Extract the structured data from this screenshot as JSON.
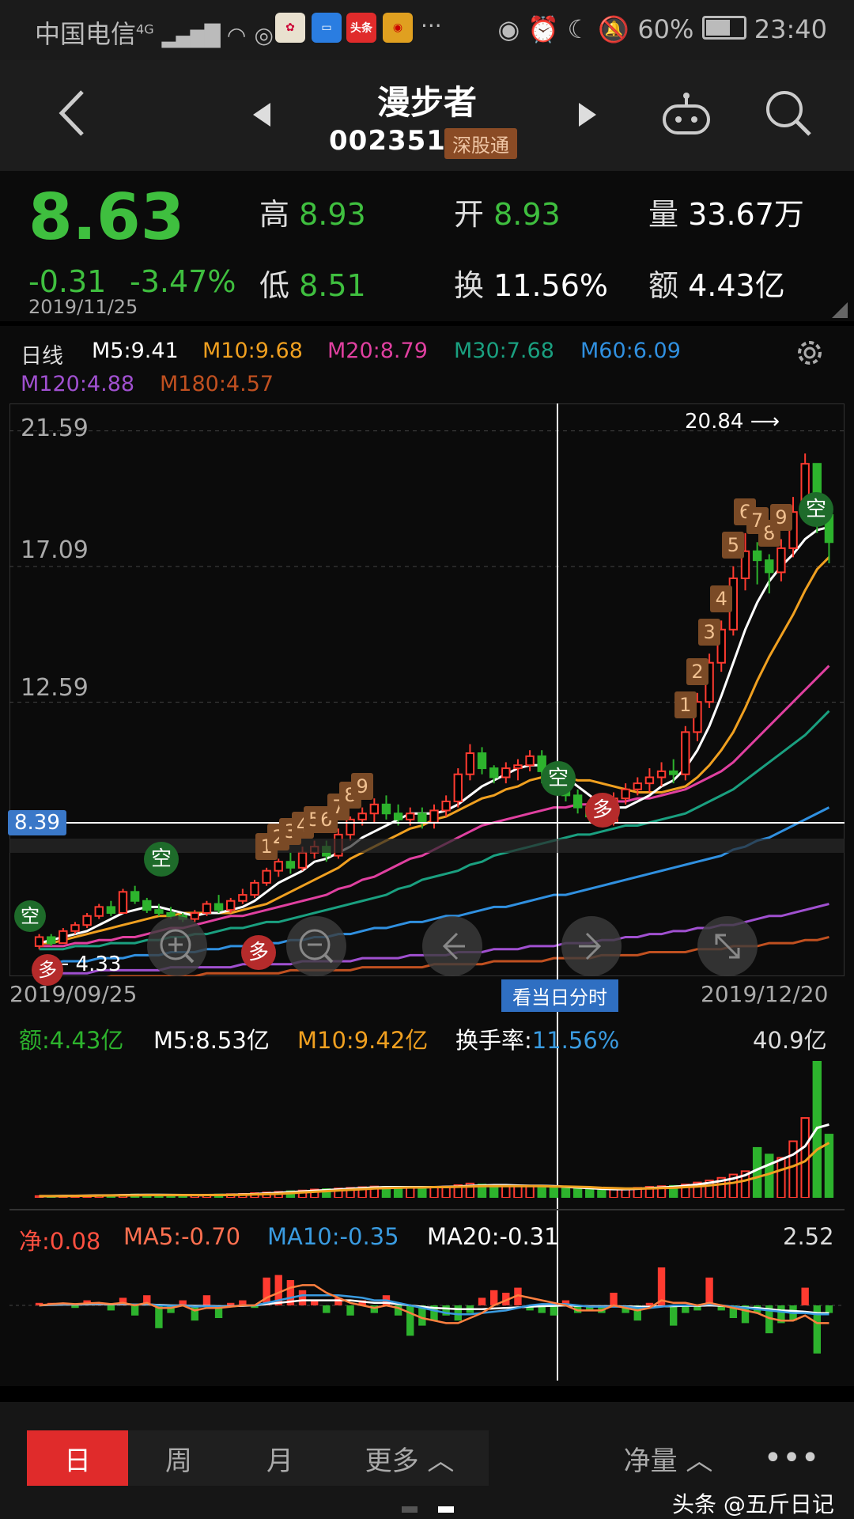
{
  "status_bar": {
    "carrier": "中国电信",
    "network": "4G",
    "apps": [
      {
        "name": "app1",
        "label": "",
        "color": "#e0e0e0"
      },
      {
        "name": "app2",
        "label": "",
        "color": "#2a7de1"
      },
      {
        "name": "toutiao",
        "label": "头条",
        "color": "#e02b2b"
      },
      {
        "name": "weibo",
        "label": "",
        "color": "#e0a020"
      }
    ],
    "more": "···",
    "battery": "60%",
    "time": "23:40"
  },
  "header": {
    "title": "漫步者",
    "code": "002351",
    "badge": "深股通"
  },
  "quote": {
    "price": "8.63",
    "change": "-0.31",
    "change_pct": "-3.47%",
    "date": "2019/11/25",
    "high_label": "高",
    "high": "8.93",
    "low_label": "低",
    "low": "8.51",
    "open_label": "开",
    "open": "8.93",
    "turnover_label": "换",
    "turnover": "11.56%",
    "volume_label": "量",
    "volume": "33.67万",
    "amount_label": "额",
    "amount": "4.43亿"
  },
  "legend": {
    "period": "日线",
    "items": [
      {
        "text": "M5:9.41",
        "color": "#ffffff"
      },
      {
        "text": "M10:9.68",
        "color": "#f0a020"
      },
      {
        "text": "M20:8.79",
        "color": "#e040a0"
      },
      {
        "text": "M30:7.68",
        "color": "#1aa080"
      },
      {
        "text": "M60:6.09",
        "color": "#3090e0"
      },
      {
        "text": "M120:4.88",
        "color": "#a050d0"
      },
      {
        "text": "M180:4.57",
        "color": "#c05020"
      }
    ]
  },
  "chart_data": {
    "type": "candlestick",
    "y_ticks": [
      "21.59",
      "17.09",
      "12.59"
    ],
    "ylim": [
      3.5,
      22.5
    ],
    "x_start": "2019/09/25",
    "x_end": "2019/12/20",
    "crosshair_price": "8.39",
    "max_label": "20.84",
    "min_label": "4.33",
    "crosshair_button": "看当日分时",
    "signals": [
      {
        "text": "空",
        "type": "short"
      },
      {
        "text": "多",
        "type": "long"
      },
      {
        "text": "空",
        "type": "short"
      },
      {
        "text": "多",
        "type": "long"
      },
      {
        "text": "空",
        "type": "short"
      },
      {
        "text": "多",
        "type": "long"
      },
      {
        "text": "空",
        "type": "short"
      }
    ],
    "counts": [
      "1",
      "2",
      "3",
      "4",
      "5",
      "6",
      "7",
      "8",
      "9",
      "1",
      "2",
      "3",
      "4",
      "5",
      "6",
      "7",
      "8",
      "9"
    ],
    "candles": [
      [
        4.5,
        4.8,
        4.4,
        4.9
      ],
      [
        4.8,
        4.6,
        4.5,
        4.9
      ],
      [
        4.6,
        5.0,
        4.6,
        5.1
      ],
      [
        5.0,
        5.2,
        4.9,
        5.3
      ],
      [
        5.2,
        5.5,
        5.1,
        5.6
      ],
      [
        5.5,
        5.8,
        5.4,
        5.9
      ],
      [
        5.8,
        5.6,
        5.5,
        6.0
      ],
      [
        5.6,
        6.3,
        5.6,
        6.4
      ],
      [
        6.3,
        6.0,
        5.9,
        6.5
      ],
      [
        6.0,
        5.7,
        5.6,
        6.1
      ],
      [
        5.7,
        5.6,
        5.5,
        5.9
      ],
      [
        5.6,
        5.5,
        5.4,
        5.8
      ],
      [
        5.5,
        5.4,
        5.3,
        5.6
      ],
      [
        5.4,
        5.6,
        5.3,
        5.7
      ],
      [
        5.6,
        5.9,
        5.5,
        6.0
      ],
      [
        5.9,
        5.7,
        5.6,
        6.2
      ],
      [
        5.7,
        6.0,
        5.6,
        6.1
      ],
      [
        6.0,
        6.2,
        5.9,
        6.4
      ],
      [
        6.2,
        6.6,
        6.1,
        6.7
      ],
      [
        6.6,
        7.0,
        6.5,
        7.1
      ],
      [
        7.0,
        7.3,
        6.8,
        7.4
      ],
      [
        7.3,
        7.1,
        6.9,
        7.6
      ],
      [
        7.1,
        7.6,
        7.0,
        7.8
      ],
      [
        7.6,
        7.8,
        7.4,
        8.0
      ],
      [
        7.8,
        7.5,
        7.3,
        8.0
      ],
      [
        7.5,
        8.2,
        7.4,
        8.4
      ],
      [
        8.2,
        8.7,
        8.0,
        8.8
      ],
      [
        8.7,
        8.9,
        8.5,
        9.1
      ],
      [
        8.9,
        9.2,
        8.6,
        9.4
      ],
      [
        9.2,
        8.9,
        8.7,
        9.5
      ],
      [
        8.9,
        8.7,
        8.5,
        9.2
      ],
      [
        8.7,
        8.9,
        8.5,
        9.1
      ],
      [
        8.9,
        8.6,
        8.4,
        9.1
      ],
      [
        8.6,
        9.0,
        8.4,
        9.2
      ],
      [
        9.0,
        9.3,
        8.8,
        9.5
      ],
      [
        9.3,
        10.2,
        9.1,
        10.4
      ],
      [
        10.2,
        10.9,
        10.0,
        11.2
      ],
      [
        10.9,
        10.4,
        10.2,
        11.1
      ],
      [
        10.4,
        10.1,
        9.9,
        10.5
      ],
      [
        10.1,
        10.4,
        9.9,
        10.6
      ],
      [
        10.4,
        10.5,
        10.0,
        10.7
      ],
      [
        10.5,
        10.8,
        10.3,
        11.0
      ],
      [
        10.8,
        10.3,
        9.9,
        11.0
      ],
      [
        10.3,
        9.9,
        9.6,
        10.4
      ],
      [
        9.9,
        9.5,
        9.3,
        10.0
      ],
      [
        9.5,
        9.1,
        8.9,
        9.7
      ],
      [
        9.1,
        8.8,
        8.6,
        9.3
      ],
      [
        8.9,
        8.6,
        8.5,
        8.9
      ],
      [
        8.6,
        9.4,
        8.5,
        9.6
      ],
      [
        9.4,
        9.7,
        9.2,
        9.9
      ],
      [
        9.7,
        9.9,
        9.5,
        10.1
      ],
      [
        9.9,
        10.1,
        9.6,
        10.4
      ],
      [
        10.1,
        10.3,
        9.8,
        10.6
      ],
      [
        10.3,
        10.2,
        9.9,
        10.7
      ],
      [
        10.2,
        11.6,
        10.0,
        11.8
      ],
      [
        11.6,
        12.6,
        11.3,
        12.9
      ],
      [
        12.6,
        13.9,
        12.4,
        14.2
      ],
      [
        13.9,
        15.0,
        13.6,
        15.3
      ],
      [
        15.0,
        16.7,
        14.8,
        17.1
      ],
      [
        16.7,
        17.6,
        16.3,
        18.2
      ],
      [
        17.6,
        17.3,
        16.5,
        17.9
      ],
      [
        17.3,
        16.9,
        16.2,
        17.5
      ],
      [
        16.9,
        17.7,
        16.6,
        18.0
      ],
      [
        17.7,
        18.9,
        17.4,
        19.4
      ],
      [
        18.9,
        20.5,
        18.6,
        20.84
      ],
      [
        20.5,
        18.8,
        18.2,
        20.4
      ],
      [
        18.8,
        17.9,
        17.2,
        18.9
      ]
    ],
    "ma5": [
      4.6,
      4.7,
      4.8,
      4.9,
      5.0,
      5.2,
      5.4,
      5.6,
      5.7,
      5.8,
      5.8,
      5.7,
      5.6,
      5.5,
      5.6,
      5.6,
      5.7,
      5.8,
      6.0,
      6.3,
      6.6,
      6.8,
      7.0,
      7.3,
      7.4,
      7.6,
      7.8,
      8.1,
      8.3,
      8.5,
      8.7,
      8.9,
      8.9,
      8.9,
      9.0,
      9.2,
      9.5,
      9.8,
      10.0,
      10.2,
      10.4,
      10.5,
      10.5,
      10.3,
      10.1,
      9.8,
      9.5,
      9.2,
      9.1,
      9.1,
      9.3,
      9.5,
      9.8,
      10.0,
      10.4,
      11.0,
      11.8,
      12.8,
      13.9,
      15.0,
      15.9,
      16.6,
      17.1,
      17.5,
      18.0,
      18.3,
      18.4
    ],
    "ma10": [
      4.6,
      4.6,
      4.7,
      4.8,
      4.9,
      5.0,
      5.1,
      5.2,
      5.3,
      5.4,
      5.5,
      5.5,
      5.6,
      5.6,
      5.6,
      5.6,
      5.6,
      5.7,
      5.8,
      5.9,
      6.1,
      6.3,
      6.5,
      6.7,
      6.9,
      7.1,
      7.4,
      7.6,
      7.8,
      8.0,
      8.2,
      8.4,
      8.5,
      8.7,
      8.8,
      9.0,
      9.2,
      9.4,
      9.5,
      9.7,
      9.8,
      10.0,
      10.1,
      10.1,
      10.1,
      10.0,
      10.0,
      9.9,
      9.8,
      9.7,
      9.6,
      9.6,
      9.6,
      9.7,
      9.8,
      10.1,
      10.5,
      11.0,
      11.6,
      12.4,
      13.3,
      14.1,
      14.8,
      15.5,
      16.3,
      17.0,
      17.4
    ],
    "ma20": [
      4.5,
      4.5,
      4.5,
      4.6,
      4.6,
      4.7,
      4.7,
      4.8,
      4.8,
      4.9,
      5.0,
      5.1,
      5.1,
      5.2,
      5.3,
      5.4,
      5.5,
      5.5,
      5.6,
      5.7,
      5.8,
      5.9,
      6.0,
      6.1,
      6.2,
      6.4,
      6.5,
      6.7,
      6.8,
      7.0,
      7.2,
      7.4,
      7.5,
      7.7,
      7.9,
      8.1,
      8.3,
      8.5,
      8.6,
      8.7,
      8.8,
      8.9,
      9.0,
      9.1,
      9.1,
      9.2,
      9.2,
      9.3,
      9.3,
      9.3,
      9.4,
      9.4,
      9.5,
      9.6,
      9.7,
      9.9,
      10.1,
      10.3,
      10.6,
      11.0,
      11.4,
      11.8,
      12.2,
      12.6,
      13.0,
      13.4,
      13.8
    ],
    "ma30": [
      4.4,
      4.4,
      4.4,
      4.5,
      4.5,
      4.5,
      4.6,
      4.6,
      4.6,
      4.7,
      4.7,
      4.8,
      4.8,
      4.9,
      4.9,
      5.0,
      5.1,
      5.1,
      5.2,
      5.3,
      5.3,
      5.4,
      5.5,
      5.6,
      5.7,
      5.8,
      5.9,
      6.0,
      6.1,
      6.2,
      6.4,
      6.5,
      6.7,
      6.8,
      6.9,
      7.0,
      7.2,
      7.3,
      7.5,
      7.6,
      7.7,
      7.8,
      7.9,
      8.0,
      8.1,
      8.2,
      8.2,
      8.3,
      8.4,
      8.5,
      8.5,
      8.6,
      8.7,
      8.8,
      8.9,
      9.1,
      9.3,
      9.5,
      9.7,
      10.0,
      10.3,
      10.6,
      10.9,
      11.2,
      11.5,
      11.9,
      12.3
    ],
    "ma60": [
      3.9,
      3.9,
      4.0,
      4.0,
      4.0,
      4.1,
      4.1,
      4.1,
      4.2,
      4.2,
      4.2,
      4.3,
      4.3,
      4.3,
      4.4,
      4.4,
      4.5,
      4.5,
      4.5,
      4.6,
      4.6,
      4.7,
      4.7,
      4.8,
      4.8,
      4.9,
      4.9,
      5.0,
      5.1,
      5.1,
      5.2,
      5.3,
      5.3,
      5.4,
      5.5,
      5.5,
      5.6,
      5.7,
      5.8,
      5.8,
      5.9,
      6.0,
      6.1,
      6.2,
      6.2,
      6.3,
      6.4,
      6.5,
      6.6,
      6.7,
      6.8,
      6.9,
      7.0,
      7.1,
      7.2,
      7.3,
      7.4,
      7.5,
      7.7,
      7.8,
      8.0,
      8.1,
      8.3,
      8.5,
      8.7,
      8.9,
      9.1
    ],
    "ma120": [
      3.6,
      3.6,
      3.6,
      3.6,
      3.6,
      3.7,
      3.7,
      3.7,
      3.7,
      3.7,
      3.7,
      3.8,
      3.8,
      3.8,
      3.8,
      3.8,
      3.8,
      3.9,
      3.9,
      3.9,
      3.9,
      3.9,
      4.0,
      4.0,
      4.0,
      4.0,
      4.0,
      4.1,
      4.1,
      4.1,
      4.1,
      4.2,
      4.2,
      4.2,
      4.2,
      4.3,
      4.3,
      4.3,
      4.4,
      4.4,
      4.4,
      4.5,
      4.5,
      4.5,
      4.6,
      4.6,
      4.6,
      4.7,
      4.7,
      4.8,
      4.8,
      4.9,
      4.9,
      5.0,
      5.0,
      5.1,
      5.1,
      5.2,
      5.2,
      5.3,
      5.4,
      5.5,
      5.5,
      5.6,
      5.7,
      5.8,
      5.9
    ],
    "ma180": [
      3.4,
      3.4,
      3.4,
      3.4,
      3.4,
      3.4,
      3.5,
      3.5,
      3.5,
      3.5,
      3.5,
      3.5,
      3.5,
      3.5,
      3.6,
      3.6,
      3.6,
      3.6,
      3.6,
      3.6,
      3.6,
      3.7,
      3.7,
      3.7,
      3.7,
      3.7,
      3.7,
      3.8,
      3.8,
      3.8,
      3.8,
      3.8,
      3.8,
      3.9,
      3.9,
      3.9,
      3.9,
      3.9,
      4.0,
      4.0,
      4.0,
      4.0,
      4.0,
      4.1,
      4.1,
      4.1,
      4.1,
      4.2,
      4.2,
      4.2,
      4.2,
      4.3,
      4.3,
      4.3,
      4.3,
      4.4,
      4.4,
      4.4,
      4.5,
      4.5,
      4.5,
      4.6,
      4.6,
      4.6,
      4.7,
      4.7,
      4.8
    ]
  },
  "volume_panel": {
    "amount": "额:4.43亿",
    "m5": "M5:8.53亿",
    "m10": "M10:9.42亿",
    "turnover_label": "换手率:",
    "turnover": "11.56%",
    "max": "40.9亿",
    "bars": [
      0.5,
      0.5,
      0.6,
      0.6,
      0.7,
      0.8,
      0.8,
      0.9,
      1.0,
      0.9,
      0.8,
      0.8,
      0.7,
      0.8,
      0.9,
      1.0,
      1.1,
      1.2,
      1.4,
      1.6,
      1.8,
      2.0,
      2.2,
      2.5,
      2.6,
      2.8,
      3.0,
      3.2,
      3.4,
      3.3,
      3.1,
      3.2,
      3.0,
      3.2,
      3.4,
      3.8,
      4.3,
      4.0,
      3.6,
      3.7,
      3.6,
      3.7,
      3.5,
      3.2,
      3.0,
      2.7,
      2.5,
      2.2,
      2.5,
      2.8,
      3.0,
      3.3,
      3.5,
      3.6,
      4.0,
      4.6,
      5.2,
      6.0,
      7.0,
      8.0,
      15.0,
      13.0,
      12.0,
      17.0,
      24.0,
      40.9,
      19.0
    ],
    "bars_up": [
      1,
      0,
      1,
      1,
      1,
      1,
      0,
      1,
      0,
      0,
      0,
      0,
      0,
      1,
      1,
      0,
      1,
      1,
      1,
      1,
      1,
      0,
      1,
      1,
      0,
      1,
      1,
      1,
      1,
      0,
      0,
      1,
      0,
      1,
      1,
      1,
      1,
      0,
      0,
      1,
      1,
      1,
      0,
      0,
      0,
      0,
      0,
      0,
      1,
      1,
      1,
      1,
      1,
      0,
      1,
      1,
      1,
      1,
      1,
      1,
      0,
      0,
      1,
      1,
      1,
      0,
      0
    ],
    "m5_line": [
      0.5,
      0.5,
      0.55,
      0.6,
      0.65,
      0.7,
      0.75,
      0.8,
      0.85,
      0.9,
      0.88,
      0.85,
      0.82,
      0.8,
      0.82,
      0.85,
      0.9,
      1.0,
      1.1,
      1.3,
      1.5,
      1.7,
      1.9,
      2.1,
      2.3,
      2.5,
      2.7,
      2.9,
      3.1,
      3.2,
      3.2,
      3.2,
      3.2,
      3.2,
      3.3,
      3.4,
      3.6,
      3.7,
      3.8,
      3.8,
      3.7,
      3.6,
      3.6,
      3.5,
      3.3,
      3.1,
      2.9,
      2.7,
      2.6,
      2.6,
      2.7,
      2.9,
      3.1,
      3.3,
      3.6,
      4.0,
      4.5,
      5.1,
      5.8,
      6.8,
      8.5,
      10.0,
      11.5,
      13.0,
      15.5,
      21.0,
      22.0
    ],
    "m10_line": [
      0.5,
      0.5,
      0.5,
      0.55,
      0.6,
      0.65,
      0.7,
      0.72,
      0.75,
      0.8,
      0.8,
      0.8,
      0.8,
      0.8,
      0.8,
      0.82,
      0.85,
      0.9,
      1.0,
      1.1,
      1.2,
      1.4,
      1.6,
      1.8,
      2.0,
      2.2,
      2.4,
      2.6,
      2.8,
      2.9,
      3.0,
      3.1,
      3.1,
      3.2,
      3.2,
      3.3,
      3.4,
      3.5,
      3.5,
      3.5,
      3.5,
      3.5,
      3.5,
      3.4,
      3.4,
      3.3,
      3.2,
      3.0,
      2.9,
      2.8,
      2.8,
      2.8,
      2.9,
      3.0,
      3.2,
      3.4,
      3.7,
      4.1,
      4.5,
      5.2,
      6.2,
      7.2,
      8.4,
      9.5,
      11.0,
      14.5,
      16.5
    ]
  },
  "flow_panel": {
    "net": "净:0.08",
    "ma5": "MA5:-0.70",
    "ma10": "MA10:-0.35",
    "ma20": "MA20:-0.31",
    "max": "2.52",
    "bars": [
      0.1,
      0.1,
      0.1,
      -0.1,
      0.2,
      0.1,
      -0.2,
      0.3,
      -0.4,
      0.4,
      -0.9,
      -0.3,
      0.2,
      -0.6,
      0.4,
      -0.5,
      0.1,
      0.2,
      -0.1,
      1.1,
      1.2,
      1.0,
      0.6,
      0.2,
      -0.3,
      0.3,
      -0.4,
      0.2,
      -0.3,
      0.4,
      -0.4,
      -1.2,
      -0.8,
      -0.6,
      -0.4,
      -0.6,
      -0.3,
      0.3,
      0.6,
      0.5,
      0.7,
      -0.2,
      -0.3,
      -0.4,
      0.2,
      -0.3,
      -0.2,
      -0.3,
      0.5,
      -0.3,
      -0.6,
      0.1,
      1.5,
      -0.8,
      -0.3,
      -0.2,
      1.1,
      -0.2,
      -0.5,
      -0.7,
      -0.3,
      -1.1,
      -0.7,
      -0.6,
      0.7,
      -1.9,
      -0.3
    ],
    "ma5_line": [
      0,
      0.05,
      0.08,
      0.05,
      0.08,
      0.1,
      0.05,
      0.1,
      0.0,
      0.1,
      -0.1,
      -0.1,
      0.0,
      -0.2,
      -0.1,
      -0.1,
      -0.05,
      0.0,
      0.0,
      0.3,
      0.5,
      0.7,
      0.8,
      0.8,
      0.5,
      0.3,
      0.1,
      0.0,
      -0.1,
      0.0,
      -0.1,
      -0.3,
      -0.5,
      -0.6,
      -0.7,
      -0.7,
      -0.5,
      -0.3,
      0.0,
      0.2,
      0.4,
      0.3,
      0.2,
      0.1,
      0.0,
      -0.2,
      -0.2,
      -0.2,
      0.0,
      -0.1,
      -0.2,
      -0.1,
      0.2,
      0.1,
      0.1,
      0.0,
      0.1,
      0.0,
      -0.1,
      -0.2,
      -0.3,
      -0.5,
      -0.6,
      -0.6,
      -0.4,
      -0.7,
      -0.7
    ],
    "ma10_line": [
      0,
      0.03,
      0.05,
      0.04,
      0.06,
      0.07,
      0.05,
      0.07,
      0.03,
      0.06,
      0.0,
      -0.02,
      0.0,
      -0.05,
      -0.03,
      -0.05,
      -0.04,
      0.0,
      0.0,
      0.1,
      0.2,
      0.3,
      0.4,
      0.4,
      0.4,
      0.4,
      0.35,
      0.3,
      0.2,
      0.2,
      0.1,
      0.0,
      -0.1,
      -0.2,
      -0.3,
      -0.35,
      -0.35,
      -0.3,
      -0.25,
      -0.2,
      -0.1,
      0.0,
      0.05,
      0.05,
      0.05,
      0.0,
      -0.05,
      -0.05,
      -0.05,
      -0.05,
      -0.1,
      -0.1,
      -0.05,
      0.0,
      0.0,
      0.0,
      0.05,
      0.0,
      -0.05,
      -0.1,
      -0.15,
      -0.2,
      -0.25,
      -0.3,
      -0.3,
      -0.35,
      -0.35
    ],
    "ma20_line": [
      0,
      0.02,
      0.03,
      0.03,
      0.04,
      0.05,
      0.04,
      0.05,
      0.03,
      0.04,
      0.02,
      0.0,
      0.0,
      -0.02,
      -0.02,
      -0.03,
      -0.03,
      -0.02,
      0.0,
      0.05,
      0.1,
      0.15,
      0.2,
      0.2,
      0.2,
      0.2,
      0.2,
      0.15,
      0.1,
      0.1,
      0.05,
      0.0,
      -0.05,
      -0.1,
      -0.12,
      -0.15,
      -0.15,
      -0.15,
      -0.12,
      -0.1,
      -0.08,
      -0.05,
      -0.03,
      -0.02,
      0.0,
      -0.02,
      -0.03,
      -0.03,
      -0.03,
      -0.04,
      -0.05,
      -0.05,
      -0.04,
      -0.03,
      -0.02,
      -0.02,
      0.0,
      -0.02,
      -0.05,
      -0.08,
      -0.1,
      -0.15,
      -0.2,
      -0.22,
      -0.25,
      -0.3,
      -0.31
    ]
  },
  "controls": {
    "zoom_in": "zoom-in",
    "zoom_out": "zoom-out",
    "prev": "prev",
    "next": "next",
    "fullscreen": "fullscreen"
  },
  "tabs": {
    "items": [
      "日",
      "周",
      "月",
      "更多"
    ],
    "active": 0,
    "indicator": "净量",
    "watermark": "头条 @五斤日记"
  },
  "colors": {
    "up": "#ff3b30",
    "down": "#2db32d",
    "accent_blue": "#3080d0"
  }
}
